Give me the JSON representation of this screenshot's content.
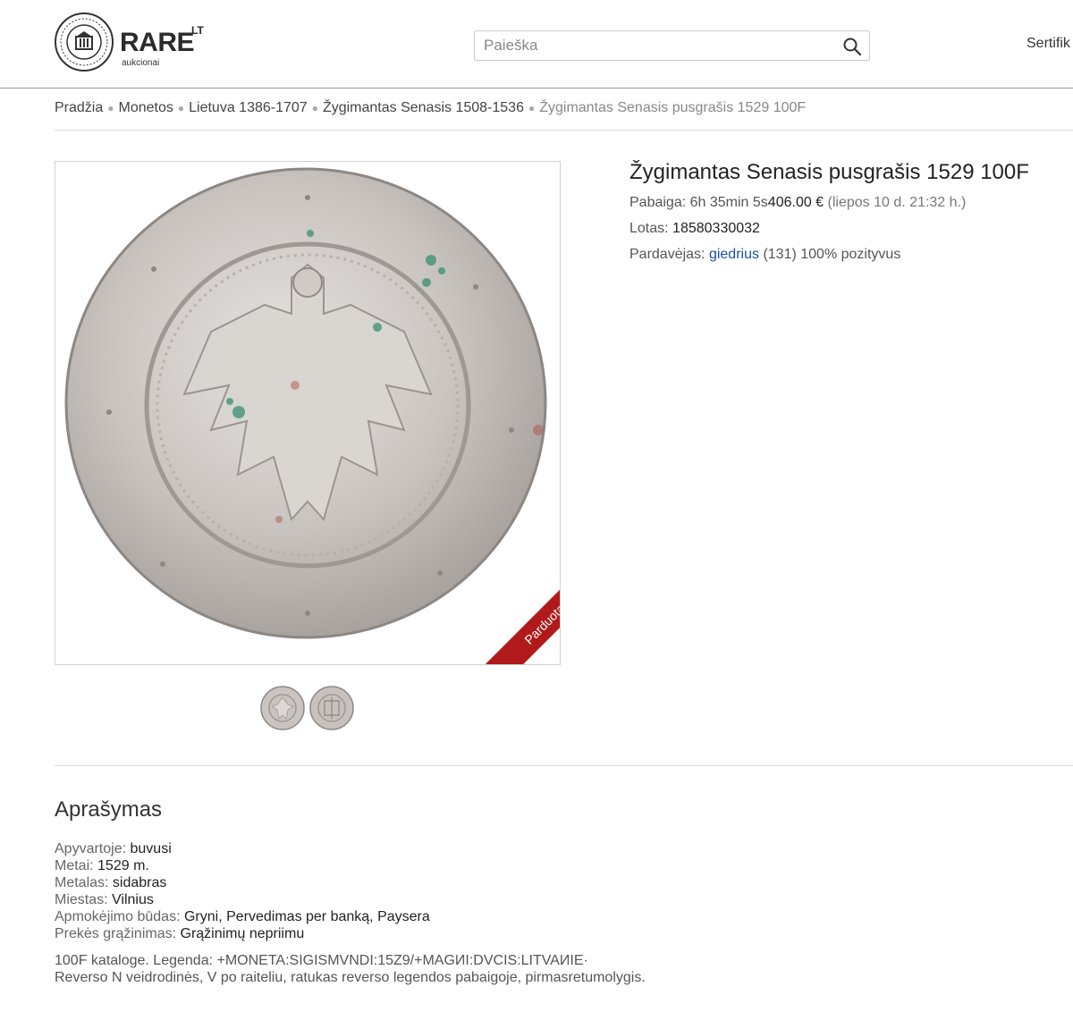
{
  "header": {
    "logo_main": "RARE",
    "logo_sup": "LT",
    "logo_sub": "aukcionai",
    "search_placeholder": "Paieška",
    "nav_item": "Sertifik"
  },
  "breadcrumb": [
    "Pradžia",
    "Monetos",
    "Lietuva 1386-1707",
    "Žygimantas Senasis 1508-1536",
    "Žygimantas Senasis pusgrašis 1529 100F"
  ],
  "lot": {
    "title": "Žygimantas Senasis pusgrašis 1529 100F",
    "end_label": "Pabaiga:",
    "end_time": "6h 35min 5s",
    "price": "406.00 €",
    "end_date": "(liepos 10 d. 21:32 h.)",
    "lot_label": "Lotas:",
    "lot_number": "18580330032",
    "seller_label": "Pardavėjas:",
    "seller_name": "giedrius",
    "seller_count": "(131)",
    "seller_rating": "100% pozityvus",
    "ribbon": "Parduota"
  },
  "description": {
    "title": "Aprašymas",
    "properties": [
      {
        "label": "Apyvartoje:",
        "value": "buvusi"
      },
      {
        "label": "Metai:",
        "value": "1529 m."
      },
      {
        "label": "Metalas:",
        "value": "sidabras"
      },
      {
        "label": "Miestas:",
        "value": "Vilnius"
      },
      {
        "label": "Apmokėjimo būdas:",
        "value": "Gryni, Pervedimas per banką, Paysera"
      },
      {
        "label": "Prekės grąžinimas:",
        "value": "Grąžinimų nepriimu"
      }
    ],
    "text_line1": "100F kataloge. Legenda: +MONETA:SIGISMVNDI:15Z9/+MAGИI:DVCIS:LITVAИIE·",
    "text_line2": "Reverso N veidrodinės, V po raiteliu, ratukas reverso legendos pabaigoje, pirmasretumolygis."
  },
  "colors": {
    "ribbon": "#b01a1a",
    "link": "#1a4fa3"
  }
}
